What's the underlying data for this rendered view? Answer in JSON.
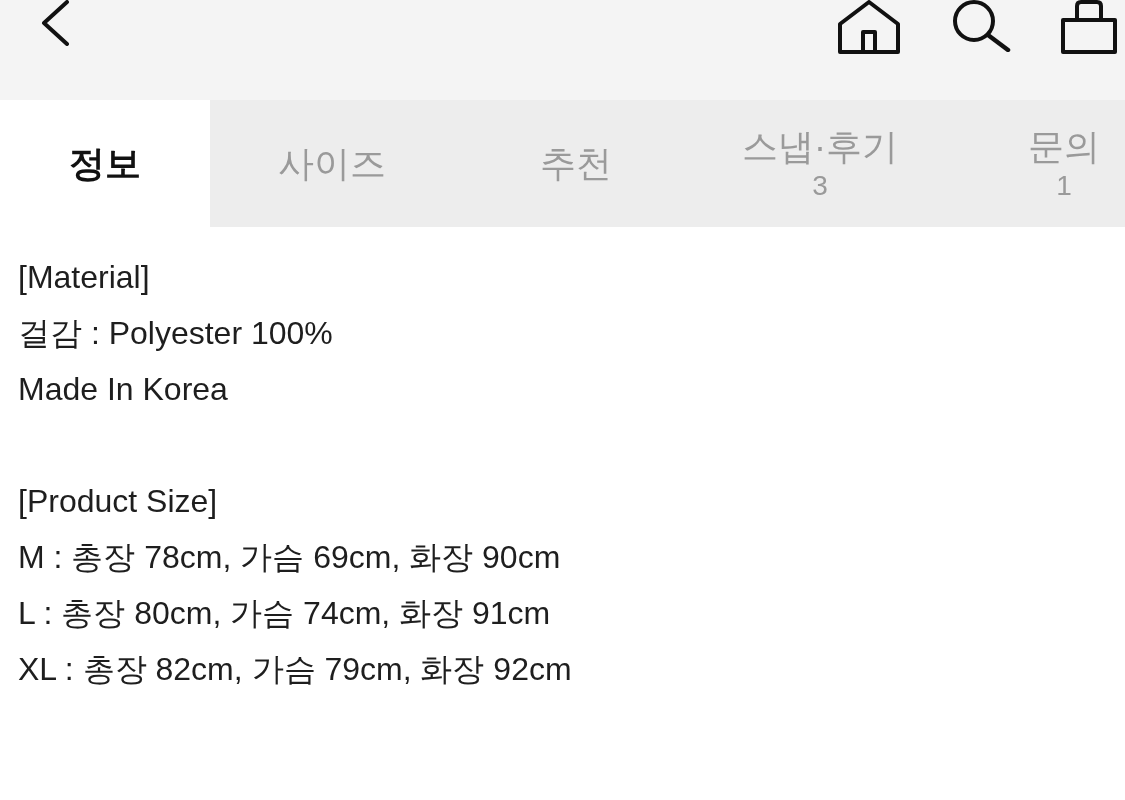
{
  "tabs": [
    {
      "label": "정보",
      "selected": true
    },
    {
      "label": "사이즈",
      "selected": false
    },
    {
      "label": "추천",
      "selected": false
    },
    {
      "label": "스냅·후기",
      "count": "3",
      "selected": false
    },
    {
      "label": "문의",
      "count": "1",
      "selected": false
    }
  ],
  "description": {
    "sections": [
      {
        "lines": [
          "[Material]",
          "걸감 : Polyester 100%",
          "Made In Korea"
        ]
      },
      {
        "lines": [
          "[Product Size]",
          "M : 총장 78cm, 가슴 69cm, 화장 90cm",
          "L : 총장 80cm, 가슴 74cm, 화장 91cm",
          "XL : 총장 82cm, 가슴 79cm, 화장 92cm"
        ]
      }
    ]
  }
}
